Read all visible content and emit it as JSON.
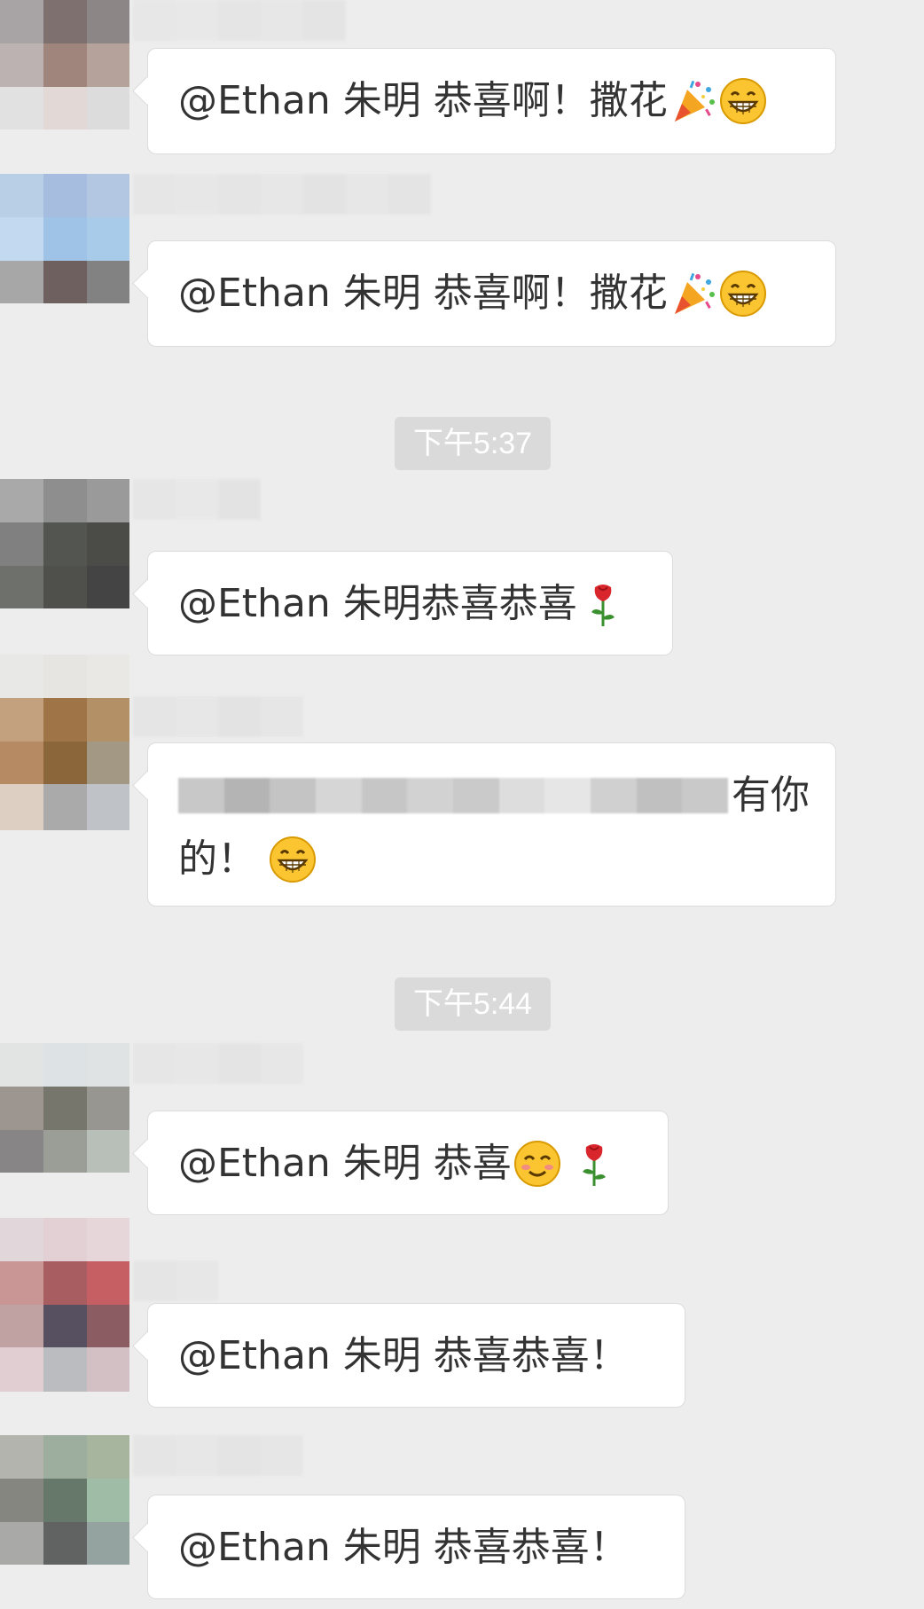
{
  "chat": {
    "messages": [
      {
        "text": "@Ethan 朱明  恭喜啊！撒花",
        "emojis": [
          "party-popper",
          "grin"
        ]
      },
      {
        "text": "@Ethan 朱明  恭喜啊！撒花",
        "emojis": [
          "party-popper",
          "grin"
        ]
      },
      {
        "timestamp": "下午5:37"
      },
      {
        "text": "@Ethan 朱明恭喜恭喜",
        "emojis": [
          "rose"
        ]
      },
      {
        "text_line1_suffix": "有你",
        "text_line2": "的！",
        "emojis": [
          "grin"
        ]
      },
      {
        "timestamp": "下午5:44"
      },
      {
        "text": "@Ethan 朱明  恭喜",
        "emojis": [
          "blush-smile",
          "rose"
        ]
      },
      {
        "text": "@Ethan 朱明  恭喜恭喜！",
        "emojis": []
      },
      {
        "text": "@Ethan 朱明  恭喜恭喜！",
        "emojis": []
      }
    ]
  },
  "colors": {
    "background": "#ededed",
    "bubble": "#ffffff",
    "bubble_border": "#dcdcdc",
    "text": "#333333",
    "timestamp_bg": "#dadada",
    "timestamp_text": "#ffffff"
  }
}
